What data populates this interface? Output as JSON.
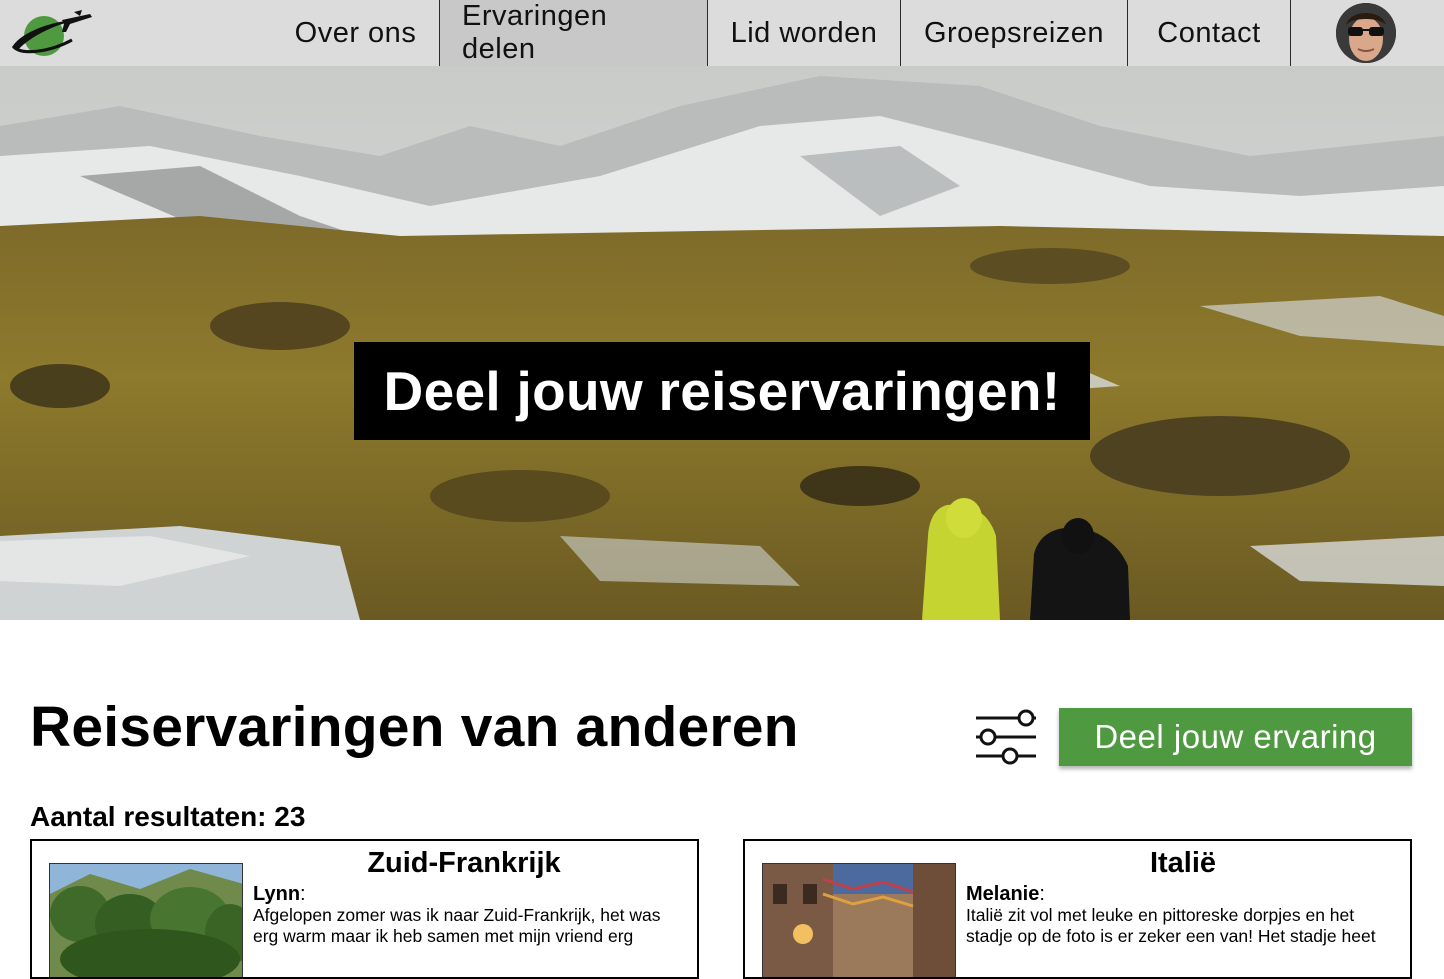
{
  "nav": {
    "items": [
      {
        "label": "Over ons"
      },
      {
        "label": "Ervaringen delen",
        "active": true
      },
      {
        "label": "Lid worden"
      },
      {
        "label": "Groepsreizen"
      },
      {
        "label": "Contact"
      }
    ],
    "logo_icon": "globe-airplane-logo",
    "avatar_icon": "user-avatar"
  },
  "hero": {
    "title": "Deel jouw reiservaringen!"
  },
  "section": {
    "title": "Reiservaringen van anderen",
    "filter_icon": "sliders-icon",
    "share_button": "Deel jouw ervaring",
    "results_label": "Aantal resultaten: 23"
  },
  "cards": [
    {
      "title": "Zuid-Frankrijk",
      "author": "Lynn",
      "text": "Afgelopen zomer was ik naar Zuid-Frankrijk, het was erg warm maar ik heb samen met mijn vriend erg"
    },
    {
      "title": "Italië",
      "author": "Melanie",
      "text": "Italië zit vol met leuke en pittoreske dorpjes en het stadje op de foto is er zeker een van! Het stadje heet"
    }
  ],
  "colors": {
    "nav_bg": "#dcdcdc",
    "nav_active": "#c8c8c8",
    "accent_green": "#4f9a40",
    "hero_title_bg": "#000000"
  }
}
